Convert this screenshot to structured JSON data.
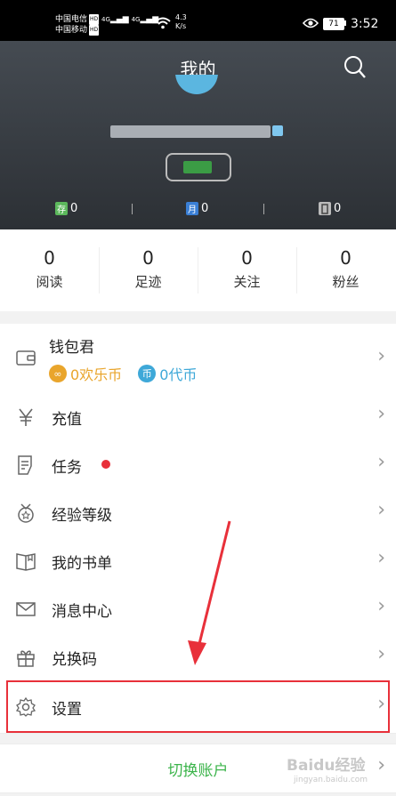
{
  "status_bar": {
    "carrier1": "中国电信",
    "carrier2": "中国移动",
    "hd": "HD",
    "signal": "4G",
    "speed_value": "4.3",
    "speed_unit": "K/s",
    "battery": "71",
    "time": "3:52"
  },
  "header": {
    "title": "我的",
    "stats": [
      {
        "icon_text": "存",
        "value": "0",
        "color": "#5cb85c"
      },
      {
        "icon_text": "月",
        "value": "0",
        "color": "#3a7fd5"
      },
      {
        "icon_text": "",
        "value": "0",
        "color": "#bbbbbb"
      }
    ]
  },
  "stats": [
    {
      "value": "0",
      "label": "阅读"
    },
    {
      "value": "0",
      "label": "足迹"
    },
    {
      "value": "0",
      "label": "关注"
    },
    {
      "value": "0",
      "label": "粉丝"
    }
  ],
  "wallet": {
    "title": "钱包君",
    "coins": [
      {
        "text": "0欢乐币",
        "icon": "∞",
        "color": "#e9a52c"
      },
      {
        "text": "0代币",
        "icon": "币",
        "color": "#3ea8d8"
      }
    ]
  },
  "menu": [
    {
      "label": "充值",
      "icon": "yen-icon"
    },
    {
      "label": "任务",
      "icon": "task-icon",
      "dot": true
    },
    {
      "label": "经验等级",
      "icon": "medal-icon"
    },
    {
      "label": "我的书单",
      "icon": "book-icon"
    },
    {
      "label": "消息中心",
      "icon": "mail-icon"
    },
    {
      "label": "兑换码",
      "icon": "gift-icon"
    },
    {
      "label": "设置",
      "icon": "gear-icon"
    }
  ],
  "switch_account": "切换账户",
  "watermark": "Baidu经验",
  "watermark_sub": "jingyan.baidu.com",
  "colors": {
    "accent_green": "#3cb44b",
    "annotation_red": "#e8303a",
    "dot_red": "#e8303a"
  }
}
